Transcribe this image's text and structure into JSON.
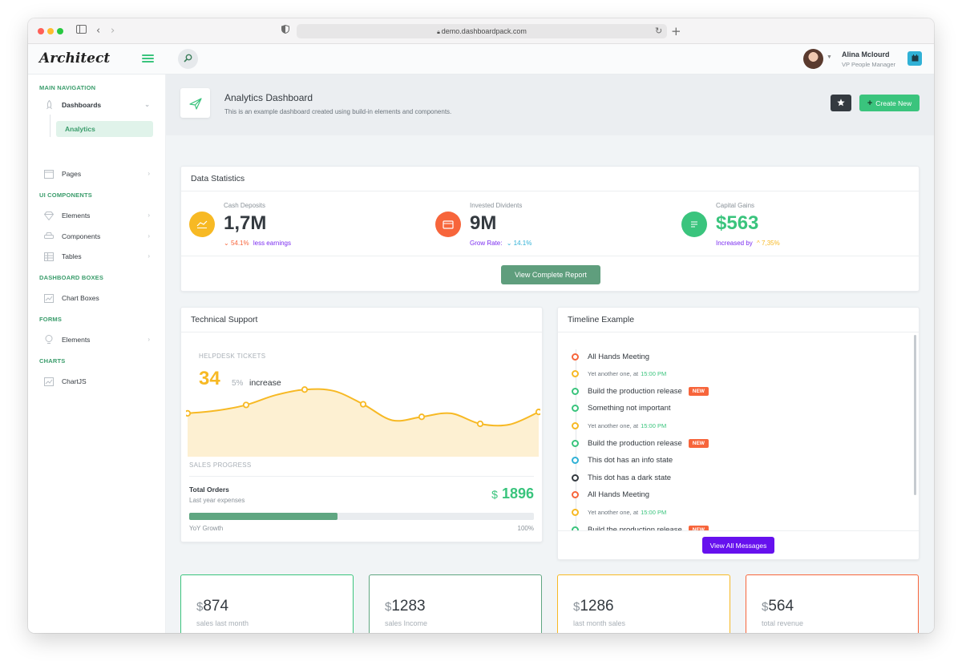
{
  "browser": {
    "url": "demo.dashboardpack.com"
  },
  "header": {
    "logo": "Architect",
    "user": {
      "name": "Alina Mclourd",
      "role": "VP People Manager"
    }
  },
  "sidebar": {
    "sections": {
      "main_navigation": "MAIN NAVIGATION",
      "ui_components": "UI COMPONENTS",
      "dashboard_boxes": "DASHBOARD BOXES",
      "forms": "FORMS",
      "charts": "CHARTS"
    },
    "items": {
      "dashboards": "Dashboards",
      "analytics": "Analytics",
      "pages": "Pages",
      "elements": "Elements",
      "components": "Components",
      "tables": "Tables",
      "chart_boxes": "Chart Boxes",
      "form_elements": "Elements",
      "chartjs": "ChartJS"
    }
  },
  "page": {
    "title": "Analytics Dashboard",
    "subtitle": "This is an example dashboard created using build-in elements and components.",
    "create_label": "Create New"
  },
  "stats_card": {
    "title": "Data Statistics",
    "items": [
      {
        "label": "Cash Deposits",
        "value": "1,7M",
        "delta": "54.1%",
        "note": "less earnings"
      },
      {
        "label": "Invested Dividents",
        "value": "9M",
        "note": "Grow Rate:",
        "delta": "14.1%"
      },
      {
        "label": "Capital Gains",
        "value": "$563",
        "note": "Increased by",
        "delta": "7,35%"
      }
    ],
    "button": "View Complete Report"
  },
  "support_card": {
    "title": "Technical Support",
    "helpdesk_label": "HELPDESK TICKETS",
    "big_number": "34",
    "percent": "5%",
    "increase_label": "increase",
    "sales_progress_label": "SALES PROGRESS",
    "orders_title": "Total Orders",
    "orders_sub": "Last year expenses",
    "orders_currency": "$",
    "orders_value": "1896",
    "yoy_label": "YoY Growth",
    "yoy_percent": "100%",
    "progress_fraction": 0.43
  },
  "chart_data": {
    "type": "area",
    "x": [
      0,
      1,
      2,
      3,
      4,
      5,
      6,
      7,
      8,
      9,
      10,
      11,
      12
    ],
    "series": [
      {
        "values": [
          6.2,
          6.6,
          7.4,
          8.8,
          9.6,
          9.4,
          7.5,
          5.2,
          5.7,
          6.2,
          4.7,
          4.6,
          6.4
        ]
      }
    ],
    "marker_indices": [
      0,
      2,
      4,
      6,
      8,
      10,
      12
    ],
    "ylim": [
      0,
      11
    ],
    "color": "#f7b924",
    "fill": "#fdf0d2"
  },
  "timeline_card": {
    "title": "Timeline Example",
    "items": [
      {
        "text": "All Hands Meeting",
        "color": "#f7653b"
      },
      {
        "text": "Yet another one, at",
        "time": "15:00 PM",
        "color": "#f7b924",
        "small": true
      },
      {
        "text": "Build the production release",
        "badge": "NEW",
        "color": "#3ac47d"
      },
      {
        "text": "Something not important",
        "color": "#3ac47d"
      },
      {
        "text": "Yet another one, at",
        "time": "15:00 PM",
        "color": "#f7b924",
        "small": true
      },
      {
        "text": "Build the production release",
        "badge": "NEW",
        "color": "#3ac47d"
      },
      {
        "text": "This dot has an info state",
        "color": "#30b1d6"
      },
      {
        "text": "This dot has a dark state",
        "color": "#343a40"
      },
      {
        "text": "All Hands Meeting",
        "color": "#f7653b"
      },
      {
        "text": "Yet another one, at",
        "time": "15:00 PM",
        "color": "#f7b924",
        "small": true
      },
      {
        "text": "Build the production release",
        "badge": "NEW",
        "color": "#3ac47d"
      }
    ],
    "button": "View All Messages"
  },
  "boxes": [
    {
      "currency": "$",
      "value": "874",
      "label": "sales last month",
      "color": "#3ac47d"
    },
    {
      "currency": "$",
      "value": "1283",
      "label": "sales Income",
      "color": "#5fa681"
    },
    {
      "currency": "$",
      "value": "1286",
      "label": "last month sales",
      "color": "#f7b924"
    },
    {
      "currency": "$",
      "value": "564",
      "label": "total revenue",
      "color": "#f7653b"
    }
  ],
  "colors": {
    "accent": "#3ac47d",
    "warning": "#f7b924",
    "danger": "#f7653b",
    "info": "#30b1d6",
    "alt": "#6611ee",
    "dark": "#343a40"
  },
  "icons": [
    "search-icon",
    "menu-icon",
    "calendar-icon",
    "star-icon",
    "plus-icon",
    "plane-icon",
    "rocket-icon",
    "browser-icon",
    "diamond-icon",
    "car-icon",
    "table-icon",
    "graph-icon",
    "bulb-icon",
    "chevron-right-icon",
    "chevron-down-icon"
  ]
}
